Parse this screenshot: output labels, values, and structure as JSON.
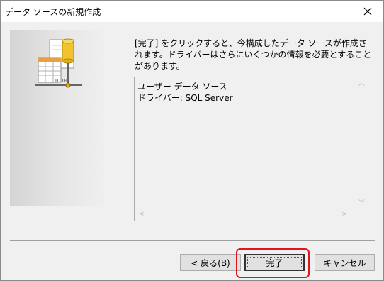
{
  "window": {
    "title": "データ ソースの新規作成"
  },
  "icons": {
    "close": "close-icon",
    "wizard": "database-datasource-icon",
    "scroll_up": "scroll-up-arrow-icon",
    "scroll_down": "scroll-down-arrow-icon",
    "scroll_left": "scroll-left-arrow-icon",
    "scroll_right": "scroll-right-arrow-icon"
  },
  "main": {
    "message": "[完了] をクリックすると、今構成したデータ ソースが作成されます。ドライバーはさらにいくつかの情報を必要とすることがあります。",
    "details": {
      "lines": [
        "ユーザー データ ソース",
        "ドライバー:  SQL Server"
      ]
    }
  },
  "buttons": {
    "back": "< 戻る(B)",
    "finish": "完了",
    "cancel": "キャンセル"
  },
  "colors": {
    "highlight": "#e0161c",
    "window_bg": "#f0f0f0"
  }
}
